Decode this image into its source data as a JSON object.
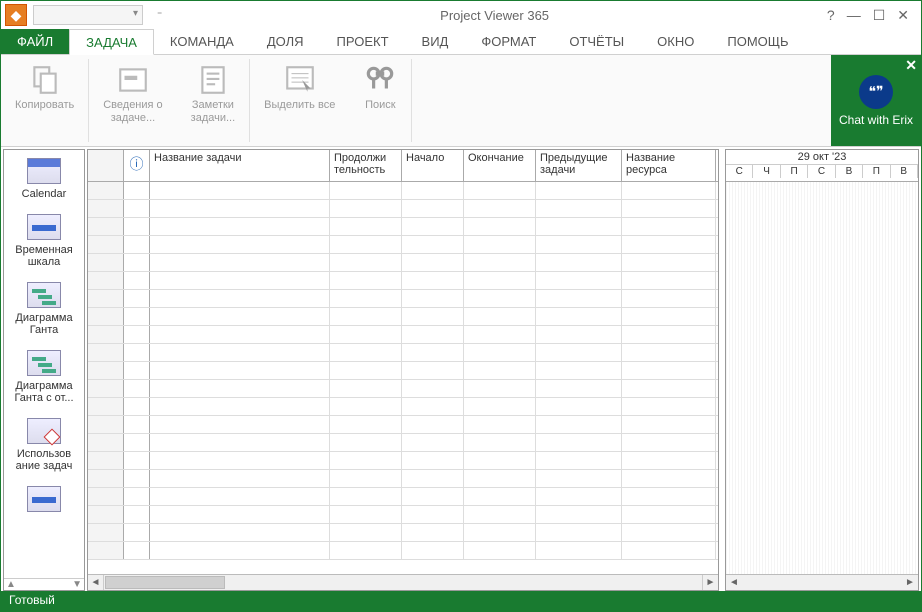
{
  "app_title": "Project Viewer 365",
  "tabs": {
    "file": "ФАЙЛ",
    "task": "ЗАДАЧА",
    "team": "КОМАНДА",
    "share": "ДОЛЯ",
    "project": "ПРОЕКТ",
    "view": "ВИД",
    "format": "ФОРМАТ",
    "reports": "ОТЧЁТЫ",
    "window": "ОКНО",
    "help": "ПОМОЩЬ"
  },
  "ribbon": {
    "copy": "Копировать",
    "task_info": "Сведения о\nзадаче...",
    "task_notes": "Заметки\nзадачи...",
    "select_all": "Выделить все",
    "find": "Поиск"
  },
  "chat": {
    "label": "Chat with Erix"
  },
  "viewbar": {
    "calendar": "Calendar",
    "timeline": "Временная\nшкала",
    "gantt": "Диаграмма\nГанта",
    "tracking_gantt": "Диаграмма\nГанта с от...",
    "task_usage": "Использов\nание задач"
  },
  "columns": {
    "name": "Название задачи",
    "duration": "Продолжи\nтельность",
    "start": "Начало",
    "finish": "Окончание",
    "predecessors": "Предыдущие\nзадачи",
    "resource_names": "Название ресурса"
  },
  "timeline": {
    "date_header": "29 окт '23",
    "days": [
      "С",
      "Ч",
      "П",
      "С",
      "В",
      "П",
      "В"
    ]
  },
  "status": "Готовый"
}
